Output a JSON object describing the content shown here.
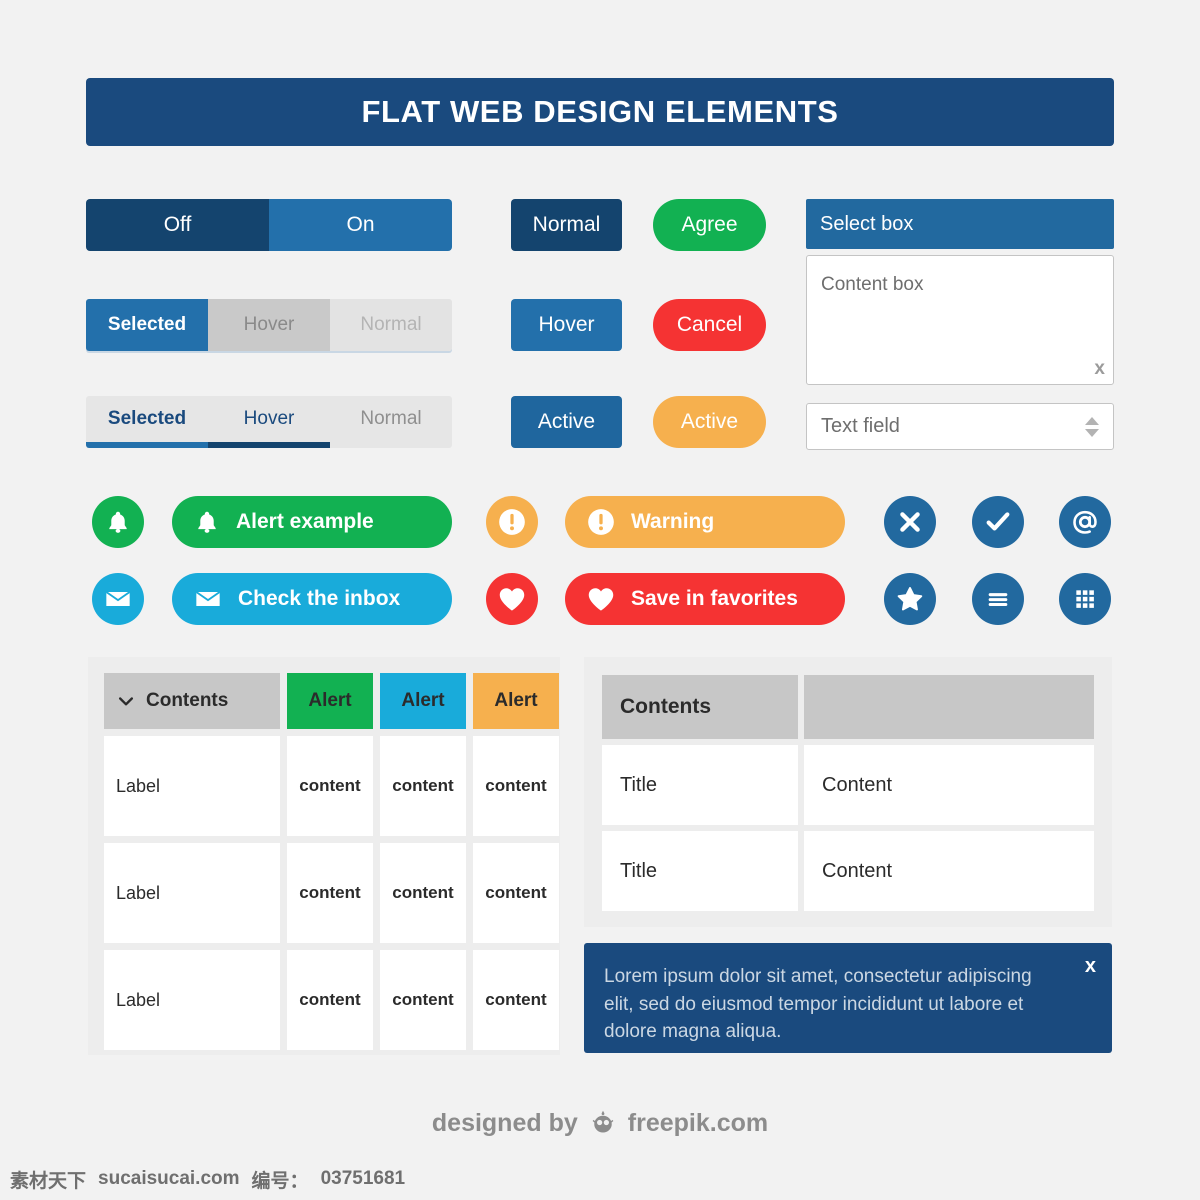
{
  "header": {
    "title": "FLAT WEB DESIGN ELEMENTS"
  },
  "toggle": {
    "off_label": "Off",
    "on_label": "On"
  },
  "tabs_boxed": [
    {
      "label": "Selected",
      "state": "selected"
    },
    {
      "label": "Hover",
      "state": "hover"
    },
    {
      "label": "Normal",
      "state": "normal"
    }
  ],
  "tabs_underline": [
    {
      "label": "Selected",
      "state": "selected"
    },
    {
      "label": "Hover",
      "state": "hover"
    },
    {
      "label": "Normal",
      "state": "normal"
    }
  ],
  "rect_buttons": [
    {
      "label": "Normal"
    },
    {
      "label": "Hover"
    },
    {
      "label": "Active"
    }
  ],
  "pill_buttons": [
    {
      "label": "Agree"
    },
    {
      "label": "Cancel"
    },
    {
      "label": "Active"
    }
  ],
  "form": {
    "select_box": "Select box",
    "content_box_placeholder": "Content box",
    "content_box_resize": "x",
    "text_field_placeholder": "Text field"
  },
  "alerts": [
    {
      "icon": "bell-icon",
      "label": "Alert example",
      "color": "#12b152"
    },
    {
      "icon": "warning-icon",
      "label": "Warning",
      "color": "#f6b04e"
    },
    {
      "icon": "envelope-icon",
      "label": "Check the inbox",
      "color": "#19abda"
    },
    {
      "icon": "heart-icon",
      "label": "Save in favorites",
      "color": "#f53333"
    }
  ],
  "blue_icons": [
    {
      "name": "close-icon"
    },
    {
      "name": "check-icon"
    },
    {
      "name": "at-icon"
    },
    {
      "name": "star-icon"
    },
    {
      "name": "menu-icon"
    },
    {
      "name": "grid-icon"
    }
  ],
  "table_left": {
    "headers": [
      "Contents",
      "Alert",
      "Alert",
      "Alert"
    ],
    "rows": [
      [
        "Label",
        "content",
        "content",
        "content"
      ],
      [
        "Label",
        "content",
        "content",
        "content"
      ],
      [
        "Label",
        "content",
        "content",
        "content"
      ]
    ]
  },
  "table_right": {
    "headers": [
      "Contents",
      ""
    ],
    "rows": [
      [
        "Title",
        "Content"
      ],
      [
        "Title",
        "Content"
      ]
    ]
  },
  "notification": {
    "message": "Lorem ipsum dolor sit amet, consectetur adipiscing elit, sed do eiusmod tempor incididunt ut labore et dolore magna aliqua.",
    "close_label": "x"
  },
  "credit": {
    "prefix": "designed by",
    "suffix": "freepik.com"
  },
  "watermark": {
    "site_cn": "素材天下",
    "site": "sucaisucai.com",
    "id_label": "编号：",
    "id_value": "03751681"
  },
  "colors": {
    "navy": "#1a4a7e",
    "blue": "#2370ab",
    "green": "#12b152",
    "cyan": "#19abda",
    "orange": "#f6b04e",
    "red": "#f53333",
    "gray_header": "#c7c7c7",
    "background": "#f2f2f2"
  }
}
